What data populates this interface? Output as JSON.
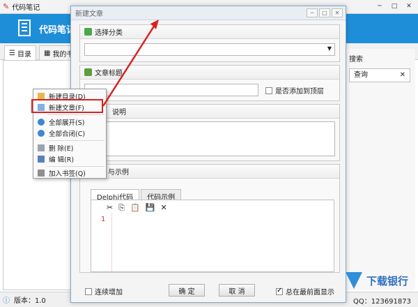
{
  "app": {
    "window_title": "代码笔记",
    "banner_title": "代码笔记",
    "version_label": "版本：1.0",
    "qq_label": "QQ：123691873"
  },
  "left_tabs": [
    {
      "label": "目录"
    },
    {
      "label": "我的书"
    }
  ],
  "right_panel": {
    "label": "搜索",
    "search_value": "查询"
  },
  "dialog": {
    "title": "新建文章",
    "category_label": "选择分类",
    "article_title_label": "文章标题",
    "pin_label": "是否添加到顶层",
    "description_label": "说明",
    "code_label": "与示例",
    "code_tabs": [
      {
        "label": "Delphi代码"
      },
      {
        "label": "代码示例"
      }
    ],
    "line_number": "1",
    "continuous_add_label": "连续增加",
    "ok_label": "确 定",
    "cancel_label": "取 消",
    "always_on_top_label": "总在最前面显示",
    "always_on_top_checked": true
  },
  "context_menu": {
    "items": [
      {
        "label": "新建目录(D)"
      },
      {
        "label": "新建文章(F)"
      },
      {
        "label": "全部展开(S)"
      },
      {
        "label": "全部合闭(C)"
      },
      {
        "label": "删 除(E)"
      },
      {
        "label": "编 辑(R)"
      },
      {
        "label": "加入书签(Q)"
      }
    ]
  },
  "watermark": {
    "text": "下载银行"
  },
  "colors": {
    "banner": "#1e8ed8",
    "highlight": "#d92121"
  }
}
